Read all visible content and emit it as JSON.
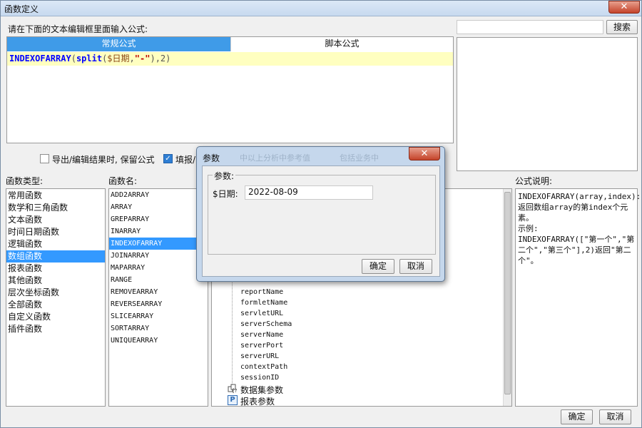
{
  "window": {
    "title": "函数定义",
    "close_glyph": "✕"
  },
  "editor": {
    "instruction": "请在下面的文本编辑框里面输入公式:",
    "tabs": [
      {
        "label": "常规公式",
        "active": true
      },
      {
        "label": "脚本公式",
        "active": false
      }
    ],
    "formula_parts": {
      "fn": "INDEXOFARRAY",
      "p1": "(",
      "fn2": "split",
      "p2": "(",
      "arg1": "$日期",
      "comma": ",",
      "arg2": "\"-\"",
      "p3": ")",
      "tail": ",2)"
    }
  },
  "search": {
    "value": "",
    "button_label": "搜索"
  },
  "options": {
    "keep_formula": {
      "label": "导出/编辑结果时, 保留公式",
      "checked": false
    },
    "fill_option": {
      "label": "填报/",
      "checked": true
    }
  },
  "function_types": {
    "header": "函数类型:",
    "items": [
      "常用函数",
      "数学和三角函数",
      "文本函数",
      "时间日期函数",
      "逻辑函数",
      "数组函数",
      "报表函数",
      "其他函数",
      "层次坐标函数",
      "全部函数",
      "自定义函数",
      "插件函数"
    ],
    "selected_index": 5
  },
  "function_names": {
    "header": "函数名:",
    "items": [
      "ADD2ARRAY",
      "ARRAY",
      "GREPARRAY",
      "INARRAY",
      "INDEXOFARRAY",
      "JOINARRAY",
      "MAPARRAY",
      "RANGE",
      "REMOVEARRAY",
      "REVERSEARRAY",
      "SLICEARRAY",
      "SORTARRAY",
      "UNIQUEARRAY"
    ],
    "selected_index": 4
  },
  "tree": {
    "items": [
      "reportName",
      "formletName",
      "servletURL",
      "serverSchema",
      "serverName",
      "serverPort",
      "serverURL",
      "contextPath",
      "sessionID"
    ],
    "groups": [
      {
        "label": "数据集参数",
        "icon": "dataset-param-icon"
      },
      {
        "label": "报表参数",
        "icon": "report-param-icon",
        "badge": "P"
      }
    ]
  },
  "description": {
    "header": "公式说明:",
    "lines": [
      "INDEXOFARRAY(array,index):",
      "返回数组array的第index个元",
      "素。",
      "示例:",
      "INDEXOFARRAY([\"第一个\",\"第",
      "二个\",\"第三个\"],2)返回\"第二",
      "个\"。"
    ]
  },
  "footer": {
    "ok_label": "确定",
    "cancel_label": "取消"
  },
  "param_dialog": {
    "title": "参数",
    "behind_title_fragments": [
      "中以上分析中参考值",
      "包括业务中"
    ],
    "group_label": "参数:",
    "param_label": "$日期:",
    "param_value": "2022-08-09",
    "ok_label": "确定",
    "cancel_label": "取消",
    "close_glyph": "✕"
  },
  "colors": {
    "accent": "#3399ff",
    "tab_active": "#3f9be8",
    "formula_bg": "#ffffc0",
    "fn_color": "#0000ff",
    "string_color": "#c00000",
    "var_color": "#8b4513"
  }
}
